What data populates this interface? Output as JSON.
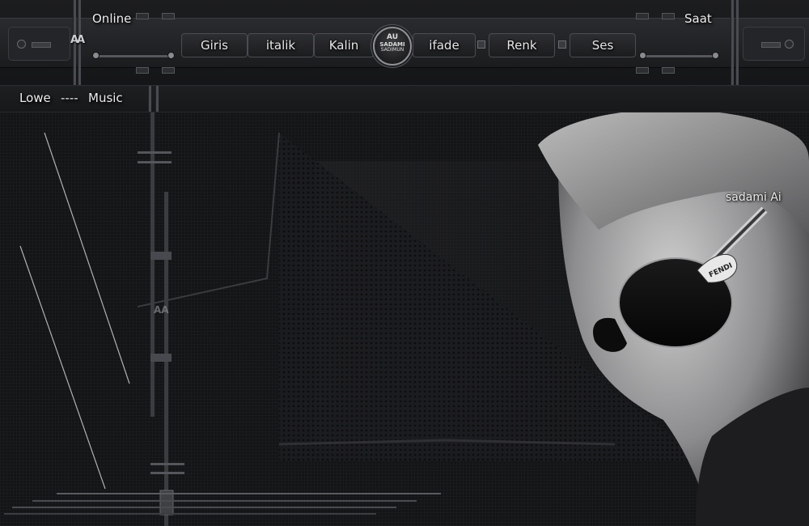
{
  "header": {
    "online_label": "Online",
    "clock_label": "Saat",
    "logo_mark": "AA",
    "badge": {
      "line1": "AU",
      "line2": "SADAMI",
      "line3": "SADIMUN"
    },
    "nav": [
      {
        "label": "Giris"
      },
      {
        "label": "italik"
      },
      {
        "label": "Kalin"
      },
      {
        "label": "ifade"
      },
      {
        "label": "Renk"
      },
      {
        "label": "Ses"
      }
    ]
  },
  "now_playing": {
    "artist": "Lowe",
    "separator": "----",
    "title": "Music"
  },
  "artwork": {
    "watermark": "AA",
    "credit": "sadami Ai",
    "glasses_brand": "FENDI"
  },
  "colors": {
    "background": "#111214",
    "panel": "#2a2b2e",
    "text": "#eeeeee"
  }
}
